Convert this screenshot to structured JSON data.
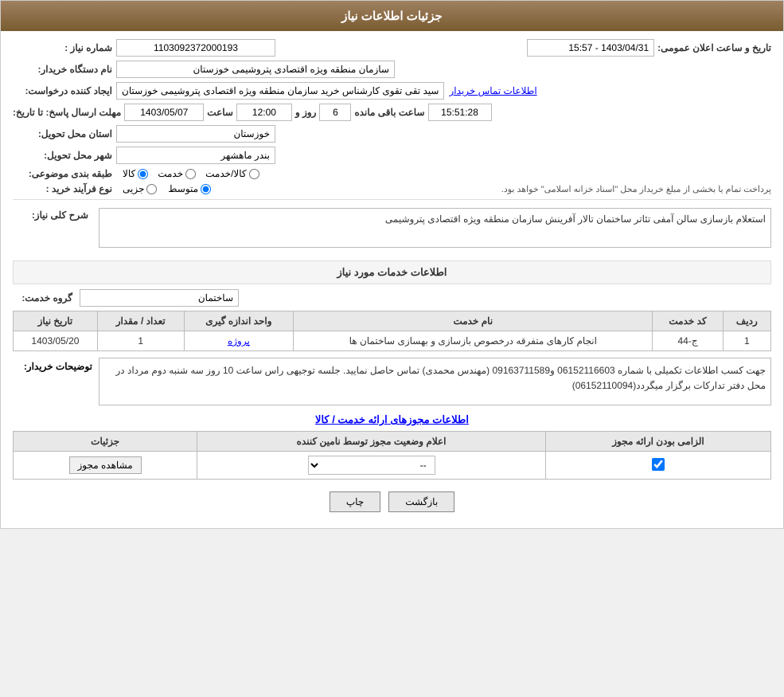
{
  "header": {
    "title": "جزئیات اطلاعات نیاز"
  },
  "fields": {
    "need_number_label": "شماره نیاز :",
    "need_number_value": "1103092372000193",
    "buyer_org_label": "نام دستگاه خریدار:",
    "buyer_org_value": "سازمان منطقه ویژه اقتصادی پتروشیمی خوزستان",
    "creator_label": "ایجاد کننده درخواست:",
    "creator_value": "سید تقی تقوی کارشناس خرید سازمان منطقه ویژه اقتصادی پتروشیمی خوزستان",
    "creator_link": "اطلاعات تماس خریدار",
    "response_deadline_label": "مهلت ارسال پاسخ: تا تاریخ:",
    "response_date": "1403/05/07",
    "response_time_label": "ساعت",
    "response_time": "12:00",
    "response_days_label": "روز و",
    "response_days": "6",
    "response_remaining_label": "ساعت باقی مانده",
    "response_remaining": "15:51:28",
    "province_label": "استان محل تحویل:",
    "province_value": "خوزستان",
    "city_label": "شهر محل تحویل:",
    "city_value": "بندر ماهشهر",
    "classification_label": "طبقه بندی موضوعی:",
    "classification_options": [
      "کالا",
      "خدمت",
      "کالا/خدمت"
    ],
    "classification_selected": "کالا",
    "process_label": "نوع فرآیند خرید :",
    "process_options": [
      "جزیی",
      "متوسط"
    ],
    "process_selected": "متوسط",
    "process_note": "پرداخت تمام یا بخشی از مبلغ خریداز محل \"اسناد خزانه اسلامی\" خواهد بود.",
    "announcement_label": "تاریخ و ساعت اعلان عمومی:",
    "announcement_value": "1403/04/31 - 15:57",
    "need_description_label": "شرح کلی نیاز:",
    "need_description_value": "استعلام بازسازی سالن آمفی تئاتر ساختمان تالار آفرینش سازمان منطقه ویژه اقتصادی پتروشیمی",
    "services_section_title": "اطلاعات خدمات مورد نیاز",
    "service_group_label": "گروه خدمت:",
    "service_group_value": "ساختمان",
    "table_headers": [
      "ردیف",
      "کد خدمت",
      "نام خدمت",
      "واحد اندازه گیری",
      "تعداد / مقدار",
      "تاریخ نیاز"
    ],
    "table_rows": [
      {
        "row": "1",
        "code": "ج-44",
        "name": "انجام کارهای متفرقه درخصوص بازسازی و بهسازی ساختمان ها",
        "unit": "پروژه",
        "quantity": "1",
        "date": "1403/05/20"
      }
    ],
    "buyer_notes_label": "توضیحات خریدار:",
    "buyer_notes_value": "جهت کسب اطلاعات تکمیلی با شماره 06152116603 و09163711589 (مهندس محمدی) تماس حاصل نمایید. جلسه توجیهی راس ساعت 10 روز سه شنبه دوم مرداد در محل دفتر تدارکات برگزار میگردد(06152110094)",
    "permit_section_title": "اطلاعات مجوزهای ارائه خدمت / کالا",
    "permit_table_headers": [
      "الزامی بودن ارائه مجوز",
      "اعلام وضعیت مجوز توسط نامین کننده",
      "جزئیات"
    ],
    "permit_table_row": {
      "mandatory": true,
      "status": "--",
      "details_btn": "مشاهده مجوز"
    },
    "btn_print": "چاپ",
    "btn_back": "بازگشت",
    "dropdown_placeholder": "▼"
  }
}
